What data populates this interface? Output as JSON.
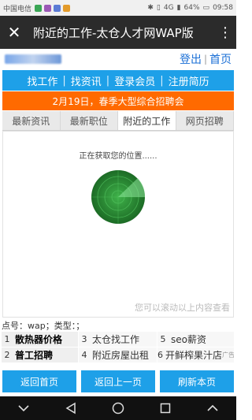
{
  "status_bar": {
    "carrier": "中国电信",
    "network": "4G",
    "battery": "64%",
    "time": "09:58"
  },
  "titlebar": {
    "title": "附近的工作-太仓人才网WAP版"
  },
  "account": {
    "login": "登出",
    "separator": "|",
    "home": "首页"
  },
  "nav": {
    "items": [
      "找工作",
      "找资讯",
      "登录会员",
      "注册简历"
    ],
    "separator": "|"
  },
  "banner": {
    "text": "2月19日，春季大型综合招聘会"
  },
  "tabs": {
    "items": [
      "最新资讯",
      "最新职位",
      "附近的工作",
      "网页招聘"
    ],
    "active_index": 2
  },
  "panel": {
    "locating_text": "正在获取您的位置......",
    "scroll_hint": "您可以滚动以上内容查看"
  },
  "info": {
    "text": "点号：wap；类型：；"
  },
  "hot_links": {
    "items": [
      {
        "num": "1",
        "label": "散热器价格"
      },
      {
        "num": "3",
        "label": "太仓找工作"
      },
      {
        "num": "5",
        "label": "seo薪资"
      },
      {
        "num": "2",
        "label": "普工招聘"
      },
      {
        "num": "4",
        "label": "附近房屋出租"
      },
      {
        "num": "6",
        "label": "开鲜榨果汁店"
      }
    ],
    "ad_tag": "广告"
  },
  "buttons": {
    "back_home": "返回首页",
    "back_prev": "返回上一页",
    "refresh": "刷新本页"
  },
  "colors": {
    "nav_blue": "#1ea0e8",
    "banner_orange": "#ff6a00",
    "link_blue": "#1a6fd6"
  }
}
